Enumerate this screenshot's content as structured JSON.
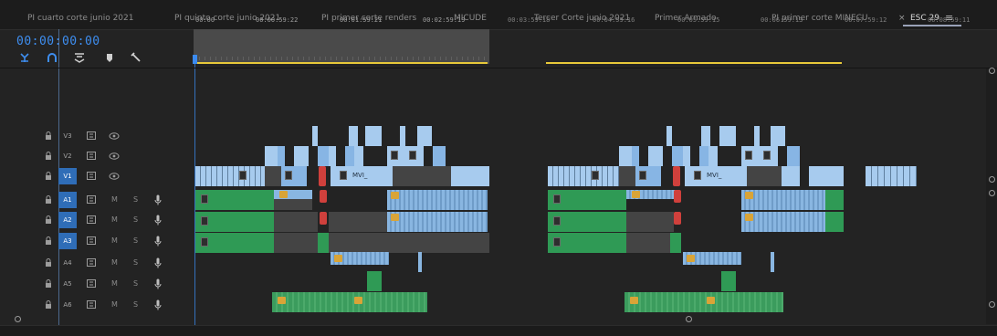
{
  "tabs": [
    {
      "label": "PI cuarto corte junio 2021"
    },
    {
      "label": "PI quinto corte junio 2021"
    },
    {
      "label": "PI primer corte renders"
    },
    {
      "label": "MICUDE"
    },
    {
      "label": "Tercer Corte junio 2021"
    },
    {
      "label": "Primer Armado"
    },
    {
      "label": "PI primer corte MINECU"
    },
    {
      "label": "ESC 29"
    }
  ],
  "close_symbol": "×",
  "menu_symbol": "≡",
  "timecode": "00:00:00:00",
  "tools": [
    "snap-icon",
    "linked-selection-icon",
    "add-marker-icon",
    "marker-icon",
    "wrench-icon"
  ],
  "ruler": {
    "labels": [
      "00:00",
      "00:00:59:22",
      "00:01:59:21",
      "00:02:59:19",
      "00:03:59:18",
      "00:04:59:16",
      "00:05:59:15",
      "00:06:59:13",
      "00:07:59:12",
      "00:08:59:11"
    ]
  },
  "tracks": [
    {
      "id": "V3",
      "type": "video",
      "target": false
    },
    {
      "id": "V2",
      "type": "video",
      "target": false
    },
    {
      "id": "V1",
      "type": "video",
      "target": true
    },
    {
      "id": "A1",
      "type": "audio",
      "target": true,
      "m": "M",
      "s": "S"
    },
    {
      "id": "A2",
      "type": "audio",
      "target": true,
      "m": "M",
      "s": "S"
    },
    {
      "id": "A3",
      "type": "audio",
      "target": true,
      "m": "M",
      "s": "S"
    },
    {
      "id": "A4",
      "type": "audio",
      "target": false,
      "m": "M",
      "s": "S"
    },
    {
      "id": "A5",
      "type": "audio",
      "target": false,
      "m": "M",
      "s": "S"
    },
    {
      "id": "A6",
      "type": "audio",
      "target": false,
      "m": "M",
      "s": "S"
    }
  ],
  "clips": {
    "v1_label_a": "MVI_",
    "v1_label_b": "MVI_"
  },
  "colors": {
    "accent": "#3e8ef0",
    "work_area": "#e7c83a",
    "video_clip": "#87b5e4",
    "audio_clip": "#2f9a55",
    "fx_badge": "#d9a437"
  }
}
